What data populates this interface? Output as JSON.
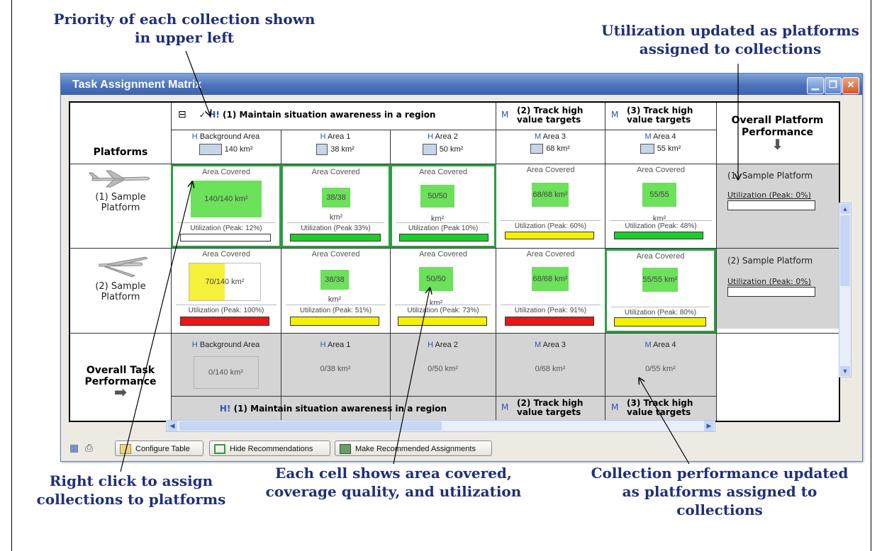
{
  "callouts": {
    "priority_l1": "Priority of each collection shown",
    "priority_l2": "in upper left",
    "utilization_l1": "Utilization updated as platforms",
    "utilization_l2": "assigned to collections",
    "rightclick_l1": "Right click to assign",
    "rightclick_l2": "collections to platforms",
    "eachcell_l1": "Each cell shows area covered,",
    "eachcell_l2": "coverage quality, and utilization",
    "collperf_l1": "Collection performance updated",
    "collperf_l2": "as platforms assigned to",
    "collperf_l3": "collections"
  },
  "window": {
    "title": "Task Assignment Matrix"
  },
  "matrix": {
    "platforms_header": "Platforms",
    "overall_platform_l1": "Overall Platform",
    "overall_platform_l2": "Performance",
    "overall_task_l1": "Overall Task",
    "overall_task_l2": "Performance",
    "collapse_glyph": "⊟",
    "collections": [
      {
        "priority": "H!",
        "name": "(1) Maintain situation awareness in a region"
      },
      {
        "priority": "M",
        "name_l1": "(2) Track high",
        "name_l2": "value targets"
      },
      {
        "priority": "M",
        "name_l1": "(3) Track high",
        "name_l2": "value targets"
      }
    ],
    "areas": [
      {
        "priority": "H",
        "name": "Background Area",
        "size": "140 km²"
      },
      {
        "priority": "H",
        "name": "Area 1",
        "size": "38 km²"
      },
      {
        "priority": "H",
        "name": "Area 2",
        "size": "50 km²"
      },
      {
        "priority": "M",
        "name": "Area 3",
        "size": "68 km²"
      },
      {
        "priority": "M",
        "name": "Area 4",
        "size": "55 km²"
      }
    ],
    "platforms": [
      {
        "name_l1": "(1) Sample",
        "name_l2": "Platform"
      },
      {
        "name_l1": "(2) Sample",
        "name_l2": "Platform"
      }
    ],
    "area_covered_label": "Area Covered",
    "cells_row1": [
      {
        "value": "140/140 km²",
        "util": "Utilization (Peak: 12%)"
      },
      {
        "value": "38/38 km²",
        "util": "Utilization (Peak 33%)"
      },
      {
        "value": "50/50 km²",
        "util": "Utilization (Peak 10%)"
      },
      {
        "value": "68/68 km²",
        "util": "Utilization (Peak: 60%)"
      },
      {
        "value": "55/55 km²",
        "util": "Utilization (Peak: 48%)"
      }
    ],
    "cells_row2": [
      {
        "value": "70/140 km²",
        "util": "Utilization (Peak: 100%)"
      },
      {
        "value": "38/38 km²",
        "util": "Utilization (Peak: 51%)"
      },
      {
        "value": "50/50 km²",
        "util": "Utilization (Peak: 73%)"
      },
      {
        "value": "68/68 km²",
        "util": "Utilization (Peak: 91%)"
      },
      {
        "value": "55/55 km²",
        "util": "Utilization (Peak: 80%)"
      }
    ],
    "bar_colors": {
      "green": "#1fcc2d",
      "yellow": "#f5f000",
      "red": "#e81818"
    },
    "platform_perf": [
      {
        "name": "(1) Sample Platform",
        "util": "Utilization (Peak: 0%)"
      },
      {
        "name": "(2) Sample Platform",
        "util": "Utilization (Peak: 0%)"
      }
    ],
    "task_perf": [
      {
        "priority": "H",
        "name": "Background Area",
        "value": "0/140 km²"
      },
      {
        "priority": "H",
        "name": "Area 1",
        "value": "0/38 km²"
      },
      {
        "priority": "H",
        "name": "Area 2",
        "value": "0/50 km²"
      },
      {
        "priority": "M",
        "name": "Area 3",
        "value": "0/68 km²"
      },
      {
        "priority": "M",
        "name": "Area 4",
        "value": "0/55 km²"
      }
    ]
  },
  "toolbar": {
    "configure": "Configure Table",
    "hide": "Hide Recommendations",
    "make": "Make Recommended Assignments"
  },
  "colors": {
    "accent": "#1f2f7a",
    "recommend_border": "#2e9c43",
    "coverage": "#6de05c",
    "partial": "#f5f03a"
  }
}
